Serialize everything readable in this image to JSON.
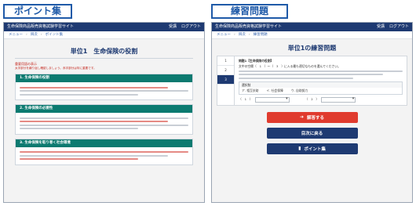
{
  "badges": {
    "left": "ポイント集",
    "right": "練習問題"
  },
  "left": {
    "topbar": {
      "title": "生命保険商品販売資格試験学習サイト",
      "user": "受講",
      "logout": "ログアウト"
    },
    "breadcrumb": [
      "メニュー",
      "目次",
      "ポイント集"
    ],
    "unit_title": "単位1　生命保険の役割",
    "note_tag": "重要用語の表示",
    "note_text": "太字部分を繰り返し確認しましょう。赤字部分は特に重要です。",
    "sections": [
      {
        "heading": "1. 生命保険の役割"
      },
      {
        "heading": "2. 生命保険の必要性"
      },
      {
        "heading": "3. 生命保険を取り巻く社会環境"
      }
    ]
  },
  "right": {
    "topbar": {
      "title": "生命保険商品販売資格試験学習サイト",
      "user": "受講",
      "logout": "ログアウト"
    },
    "breadcrumb": [
      "メニュー",
      "目次",
      "練習問題"
    ],
    "title": "単位1の練習問題",
    "question_numbers": [
      "1",
      "2",
      "3"
    ],
    "question_head": "問題1【生命保険の役割】",
    "question_text": "文中の空欄（　1　）～（　3　）に入る最も適切なものを選んでください。",
    "choices_label": "選択肢",
    "choices": [
      "ア. 相互扶助",
      "イ. 社会保障",
      "ウ. 自助努力"
    ],
    "select_labels": [
      "（　1　）",
      "（　2　）"
    ],
    "buttons": {
      "answer": "解答する",
      "back": "目次に戻る",
      "points": "ポイント集"
    }
  }
}
